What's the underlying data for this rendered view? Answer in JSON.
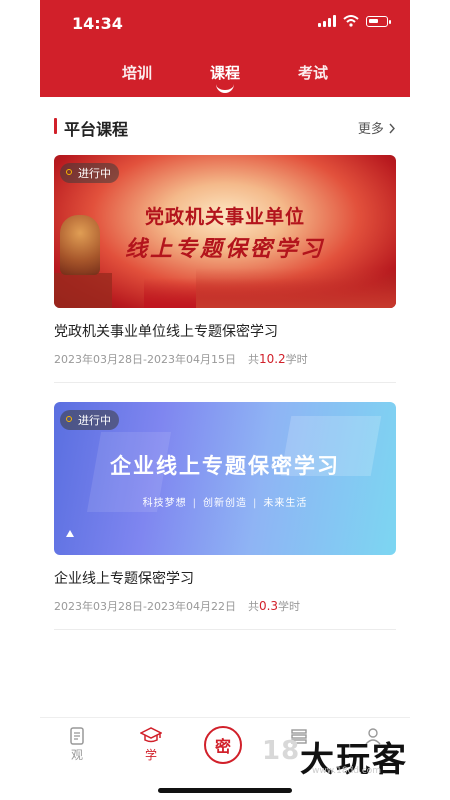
{
  "status_bar": {
    "time": "14:34"
  },
  "tabs": [
    {
      "label": "培训"
    },
    {
      "label": "课程",
      "active": true
    },
    {
      "label": "考试"
    }
  ],
  "section": {
    "title": "平台课程",
    "more": "更多"
  },
  "courses": [
    {
      "badge": "进行中",
      "banner_line1": "党政机关事业单位",
      "banner_line2": "线上专题保密学习",
      "title": "党政机关事业单位线上专题保密学习",
      "dates": "2023年03月28日-2023年04月15日",
      "hours_prefix": "共",
      "hours_value": "10.2",
      "hours_suffix": "学时"
    },
    {
      "badge": "进行中",
      "banner_title": "企业线上专题保密学习",
      "banner_tags": [
        "科技梦想",
        "创新创造",
        "未来生活"
      ],
      "title": "企业线上专题保密学习",
      "dates": "2023年03月28日-2023年04月22日",
      "hours_prefix": "共",
      "hours_value": "0.3",
      "hours_suffix": "学时"
    }
  ],
  "bottom_nav": [
    {
      "label": "观",
      "icon": "document-icon"
    },
    {
      "label": "学",
      "icon": "graduation-cap-icon",
      "active": true
    },
    {
      "label": "",
      "icon": "seal-icon",
      "glyph": "密"
    },
    {
      "label": "",
      "icon": "book-stack-icon"
    },
    {
      "label": "",
      "icon": "person-icon"
    }
  ],
  "watermark": {
    "number": "18",
    "text": "大玩客",
    "url": "www.18dd.com"
  },
  "colors": {
    "brand": "#d1202a",
    "text": "#222222",
    "muted": "#999999"
  }
}
